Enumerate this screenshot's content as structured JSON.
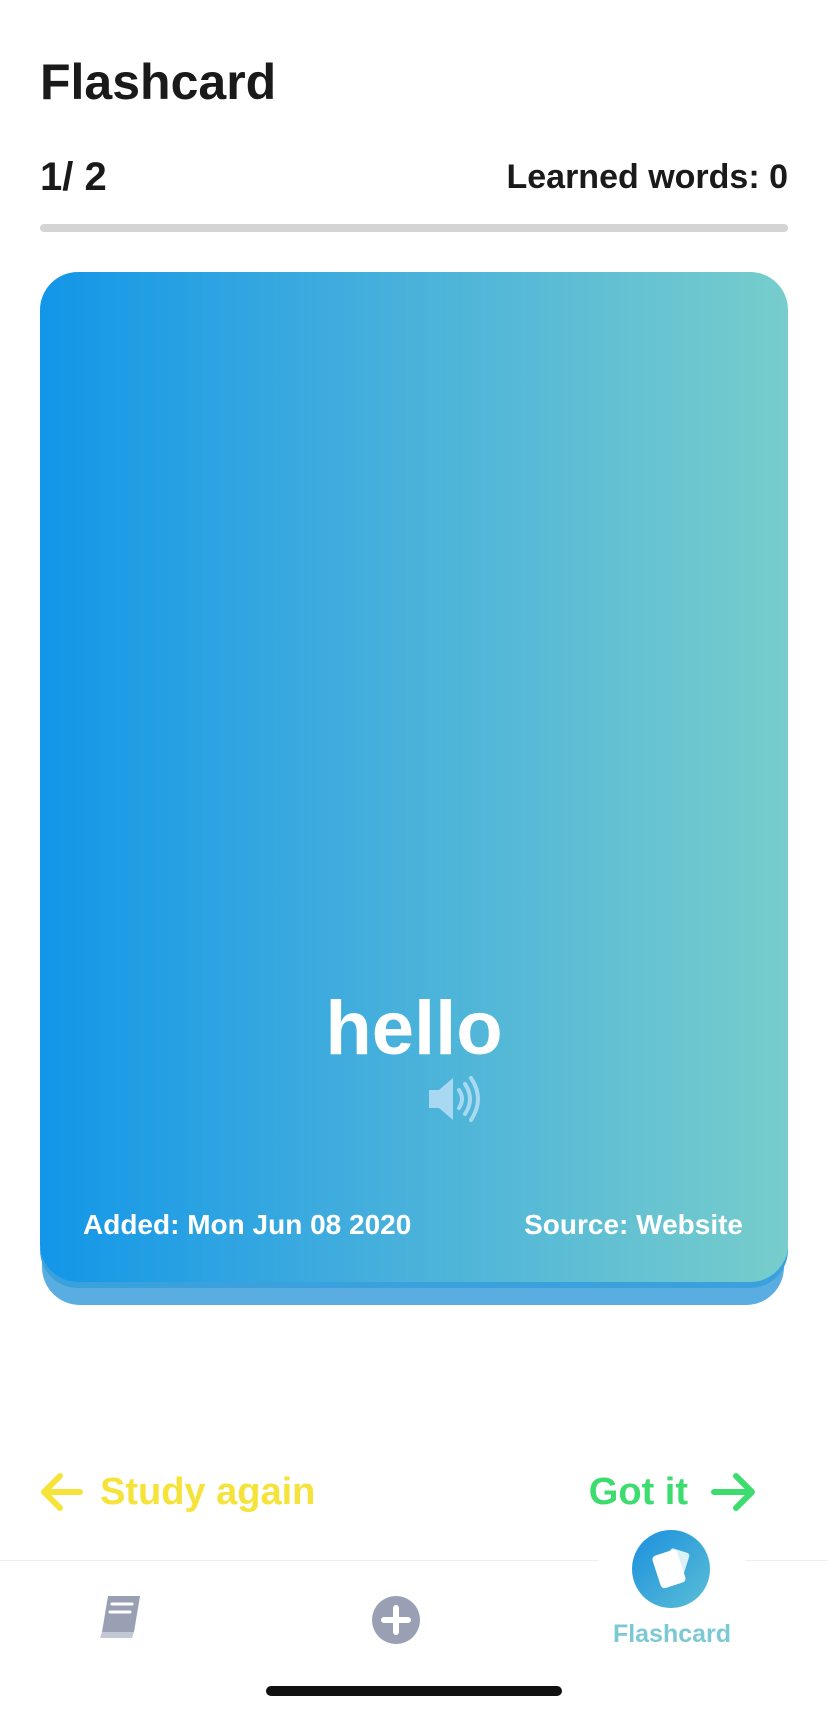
{
  "header": {
    "title": "Flashcard",
    "counter": "1/ 2",
    "learned_words": "Learned words: 0",
    "progress_fraction": 0.0,
    "progress_color": "#d4d4d4"
  },
  "card": {
    "word": "hello",
    "added": "Added: Mon Jun 08 2020",
    "source": "Source: Website",
    "gradient_start": "#1296e8",
    "gradient_end": "#77cdcb",
    "speaker_icon": "speaker-icon"
  },
  "actions": {
    "study_again": "Study again",
    "study_again_color": "#f5e33a",
    "got_it": "Got it",
    "got_it_color": "#3ddc6e"
  },
  "tabbar": {
    "tabs": [
      {
        "icon": "book-icon",
        "label": "",
        "active": false
      },
      {
        "icon": "plus-circle-icon",
        "label": "",
        "active": false
      },
      {
        "icon": "cards-icon",
        "label": "Flashcard",
        "active": true
      }
    ],
    "active_color": "#7cc9d3",
    "inactive_color": "#9aa0b4"
  }
}
